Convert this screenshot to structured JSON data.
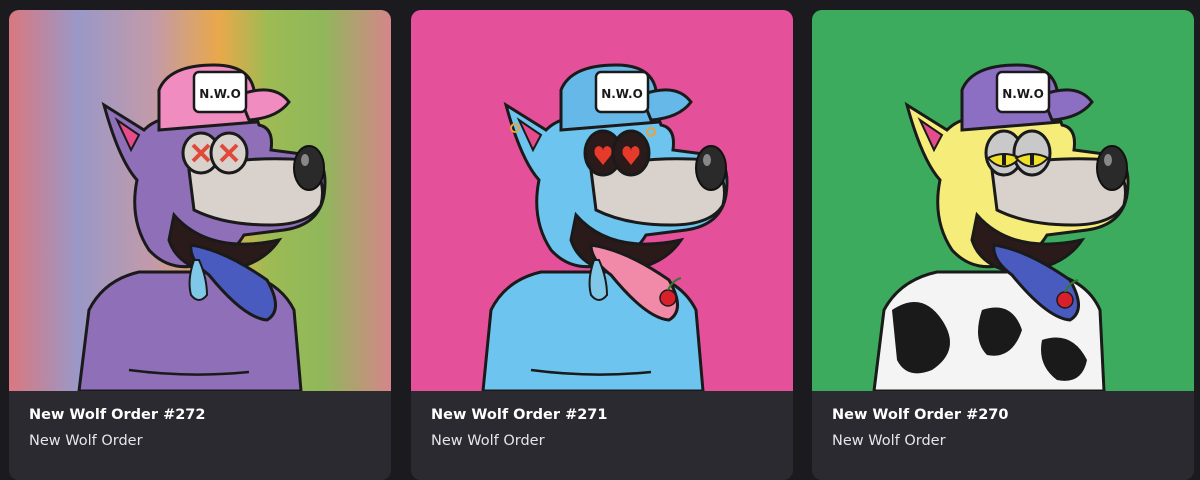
{
  "cards": [
    {
      "title": "New Wolf Order #272",
      "collection": "New Wolf Order",
      "background": "rainbow-gradient",
      "fur_color": "#8f6fb8",
      "cap_color": "#f08cc0",
      "eyes": "x-eyes",
      "cap_text": "N.W.O"
    },
    {
      "title": "New Wolf Order #271",
      "collection": "New Wolf Order",
      "background": "#e5509a",
      "fur_color": "#6cc4ef",
      "cap_color": "#66b8e8",
      "eyes": "heart-eyes",
      "cap_text": "N.W.O"
    },
    {
      "title": "New Wolf Order #270",
      "collection": "New Wolf Order",
      "background": "#3dab5e",
      "fur_color": "#f5ec7a",
      "cap_color": "#8c6ec2",
      "eyes": "yellow-eyes",
      "cap_text": "N.W.O"
    }
  ]
}
